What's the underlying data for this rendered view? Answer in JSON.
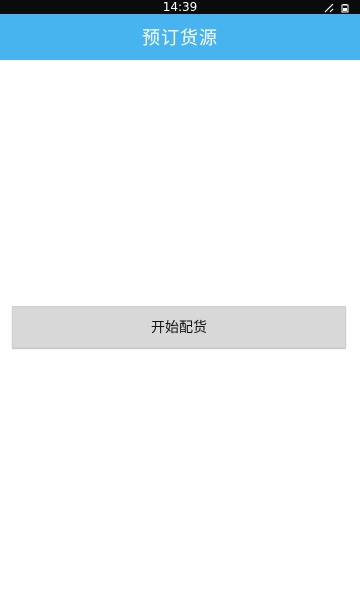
{
  "status_bar": {
    "time": "14:39",
    "icons": [
      "signal-off-icon",
      "battery-icon"
    ]
  },
  "header": {
    "title": "预订货源",
    "colors": {
      "background": "#48b4ef",
      "text": "#ffffff"
    }
  },
  "main": {
    "start_button_label": "开始配货"
  },
  "bottom_tabs": {
    "icons": [
      "tab-icon-1",
      "tab-icon-2",
      "tab-icon-3",
      "tab-icon-4"
    ]
  }
}
